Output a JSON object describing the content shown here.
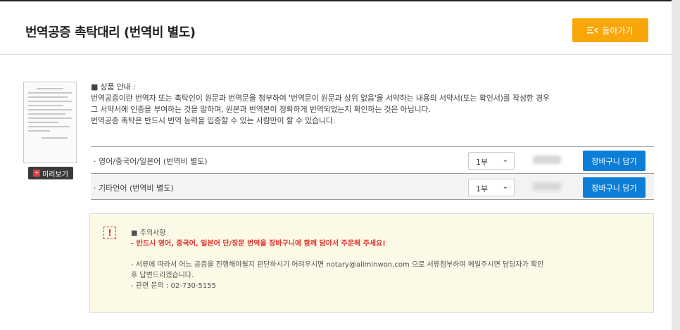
{
  "header": {
    "title": "번역공증 촉탁대리 (번역비 별도)",
    "back_label": "돌아가기"
  },
  "preview": {
    "label": "미리보기"
  },
  "info": {
    "heading": "■ 상품 안내 :",
    "lines": [
      "번역공증이란 번역자 또는 촉탁인이 원문과 번역문을 첨부하여 '번역문이 원문과 상위 없음'을 서약하는 내용의 서약서(또는 확인서)를 작성한 경우",
      "그 서약서에 인증을 부여하는 것을 말하며, 원본과 번역본이 정확하게 번역되었는지 확인하는 것은 아닙니다.",
      "번역공증 촉탁은 반드시 번역 능력을 입증할 수 있는 사람만이 할 수 있습니다."
    ]
  },
  "products": [
    {
      "name": "· 영어/중국어/일본어 (번역비 별도)",
      "qty": "1부",
      "cart_label": "장바구니 담기"
    },
    {
      "name": "· 기타언어 (번역비 별도)",
      "qty": "1부",
      "cart_label": "장바구니 담기"
    }
  ],
  "notice": {
    "heading": "■ 주의사항",
    "highlight": "- 반드시 영어, 중국어, 일본어 단/장문 번역을 장바구니에 함께 담아서 주문해 주세요!",
    "lines": [
      "- 서류에 따라서 어느 공증을 진행해야될지 판단하시기 어려우시면 notary@allminwon.com 으로 서류첨부하여 메일주시면 담당자가 확인",
      "후 답변드리겠습니다.",
      "- 관련 문의 : 02-730-5155"
    ]
  },
  "colors": {
    "back_button": "#f7a70a",
    "cart_button": "#0c7ed8",
    "notice_bg": "#fcf9e6",
    "highlight": "#e3342f"
  }
}
